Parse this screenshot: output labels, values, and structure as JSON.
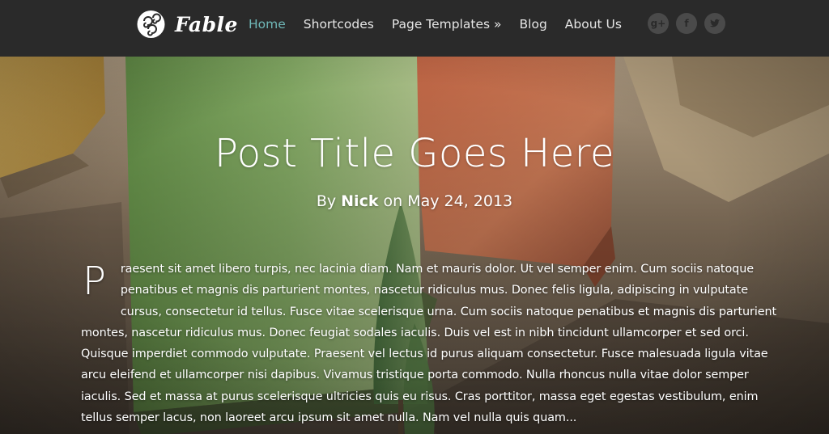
{
  "site": {
    "logo_text": "Fable"
  },
  "nav": {
    "items": [
      {
        "label": "Home",
        "active": true
      },
      {
        "label": "Shortcodes",
        "active": false
      },
      {
        "label": "Page Templates »",
        "active": false
      },
      {
        "label": "Blog",
        "active": false
      },
      {
        "label": "About Us",
        "active": false
      }
    ]
  },
  "social": [
    {
      "icon": "google-plus-icon",
      "glyph": "g+"
    },
    {
      "icon": "facebook-icon",
      "glyph": "f"
    },
    {
      "icon": "twitter-icon",
      "glyph": ""
    }
  ],
  "post": {
    "title": "Post Title Goes Here",
    "meta_prefix": "By ",
    "author": "Nick",
    "meta_middle": " on ",
    "date": "May 24, 2013",
    "dropcap": "P",
    "body": "raesent sit amet libero turpis, nec lacinia diam. Nam et mauris dolor. Ut vel semper enim. Cum sociis natoque penatibus et magnis dis parturient montes, nascetur ridiculus mus. Donec felis ligula, adipiscing in vulputate cursus, consectetur id tellus. Fusce vitae scelerisque urna. Cum sociis natoque penatibus et magnis dis parturient montes, nascetur ridiculus mus. Donec feugiat sodales iaculis. Duis vel est in nibh tincidunt ullamcorper et sed orci. Quisque imperdiet commodo vulputate. Praesent vel lectus id purus aliquam consectetur. Fusce malesuada ligula vitae arcu eleifend et ullamcorper nisi dapibus. Vivamus tristique porta commodo. Nulla rhoncus nulla vitae dolor semper iaculis. Sed et massa at purus scelerisque ultricies quis eu risus. Cras porttitor, massa eget egestas vestibulum, enim tellus semper lacus, non laoreet arcu ipsum sit amet nulla. Nam vel nulla quis quam..."
  },
  "colors": {
    "topbar": "#2a2a2a",
    "nav_active": "#6fb7b7",
    "nav_text": "#e6e6e6",
    "social_bg": "#4a4a4a"
  }
}
